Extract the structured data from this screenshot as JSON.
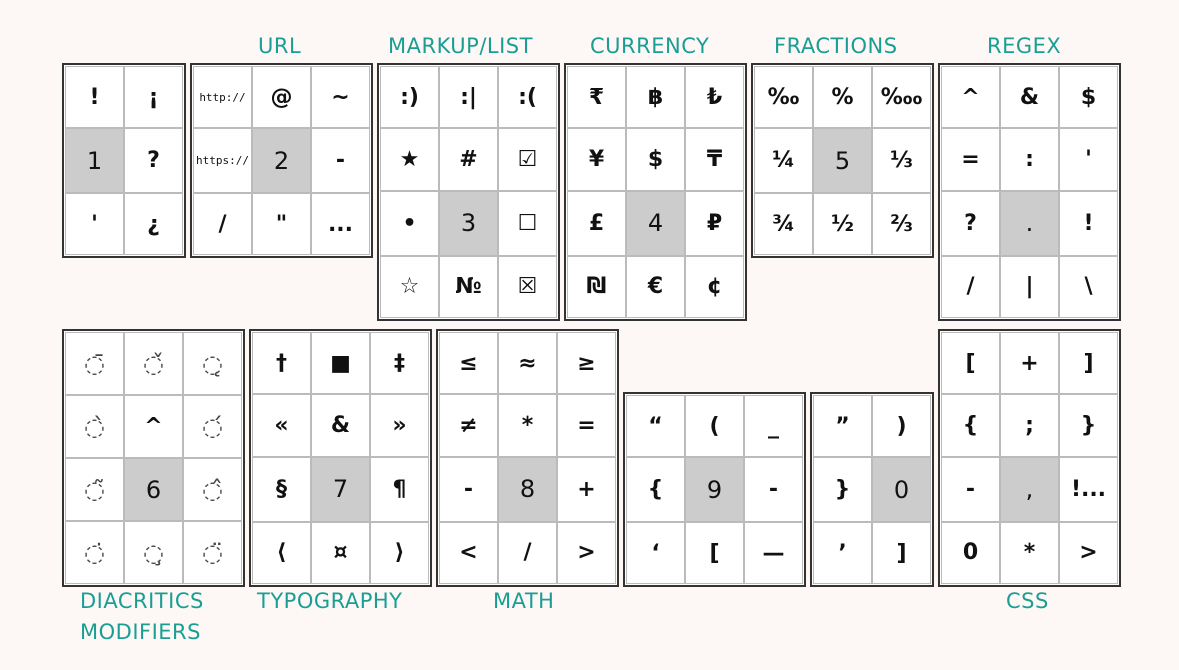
{
  "labels": {
    "url": "URL",
    "markup": "MARKUP/LIST",
    "currency": "CURRENCY",
    "fractions": "FRACTIONS",
    "regex": "REGEX",
    "diacritics": "DIACRITICS",
    "modifiers": "MODIFIERS",
    "typography": "TYPOGRAPHY",
    "math": "MATH",
    "css": "CSS"
  },
  "groups": {
    "punct": [
      "!",
      "¡",
      "1",
      "?",
      "'",
      "¿"
    ],
    "url": [
      "http://",
      "@",
      "~",
      "https://",
      "2",
      "-",
      "/",
      "\"",
      "..."
    ],
    "markup": [
      ":)",
      ":|",
      ":(",
      "★",
      "#",
      "☑",
      "•",
      "3",
      "☐",
      "☆",
      "№",
      "☒"
    ],
    "currency": [
      "₹",
      "฿",
      "₺",
      "¥",
      "$",
      "₸",
      "£",
      "4",
      "₽",
      "₪",
      "€",
      "¢"
    ],
    "fractions": [
      "‰",
      "%",
      "‱",
      "¼",
      "5",
      "⅓",
      "¾",
      "½",
      "⅔"
    ],
    "regex": [
      "^",
      "&",
      "$",
      "=",
      ":",
      "'",
      "?",
      ".",
      "!",
      "/",
      "|",
      "\\"
    ],
    "diacritics": [
      "◌̄",
      "◌̌",
      "◌̨",
      "◌̀",
      "^",
      "◌́",
      "◌̃",
      "6",
      "◌̂",
      "◌̇",
      "◌̧",
      "◌̈"
    ],
    "typography": [
      "†",
      "■",
      "‡",
      "«",
      "&",
      "»",
      "§",
      "7",
      "¶",
      "⟨",
      "¤",
      "⟩"
    ],
    "math": [
      "≤",
      "≈",
      "≥",
      "≠",
      "*",
      "=",
      "-",
      "8",
      "+",
      "<",
      "/",
      ">"
    ],
    "quotes": [
      "“",
      "(",
      "_",
      "{",
      "9",
      "-",
      "‘",
      "[",
      "—"
    ],
    "brackets": [
      "”",
      ")",
      "}",
      "0",
      "’",
      "]"
    ],
    "css": [
      "[",
      "+",
      "]",
      "{",
      ";",
      "}",
      "-",
      ",",
      "!...",
      "0",
      "*",
      ">"
    ]
  }
}
